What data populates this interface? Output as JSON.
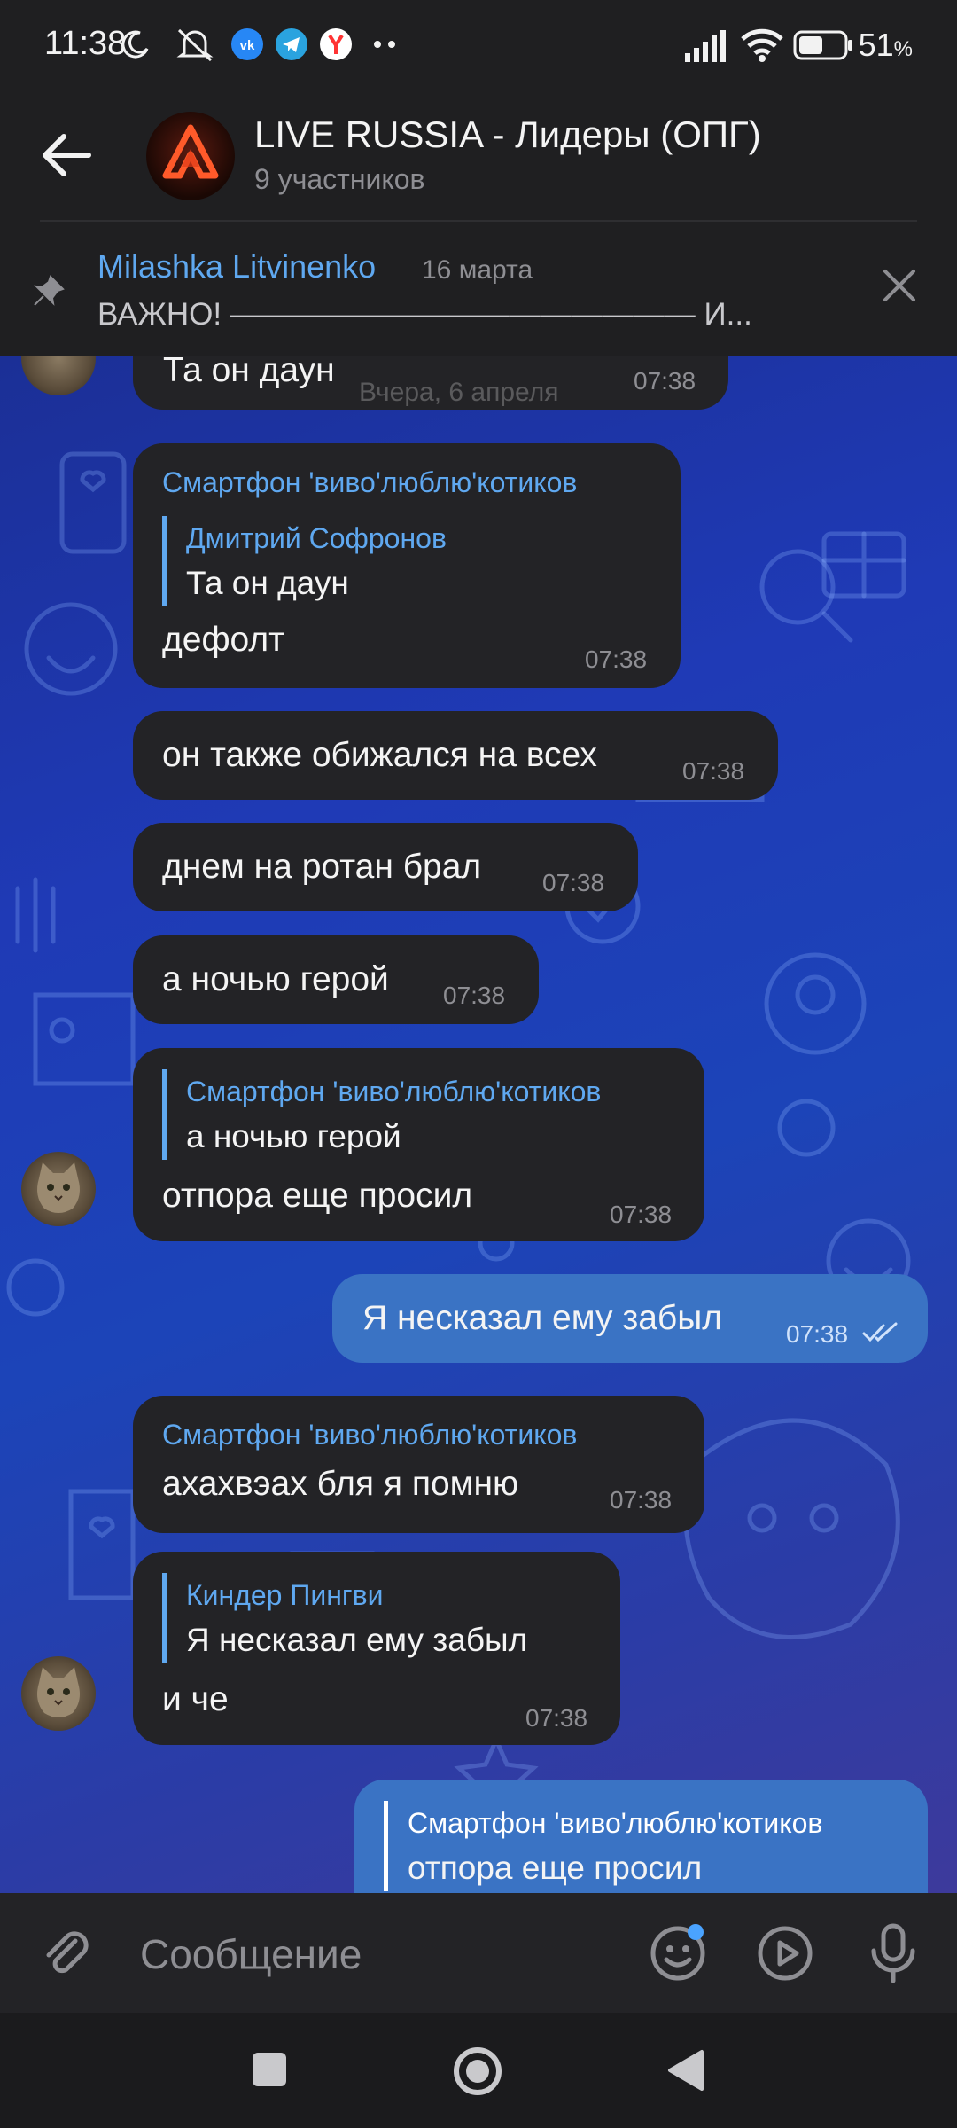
{
  "status_bar": {
    "time": "11:38",
    "battery": "51",
    "battery_unit": "%",
    "icons": [
      "moon-icon",
      "mute-icon",
      "vk-icon",
      "telegram-icon",
      "yandex-icon",
      "more-dots-icon",
      "signal-icon",
      "wifi-icon",
      "battery-icon"
    ]
  },
  "header": {
    "title": "LIVE RUSSIA - Лидеры (ОПГ)",
    "subtitle": "9 участников"
  },
  "pinned": {
    "author": "Milashka Litvinenko",
    "date": "16 марта",
    "text": "ВАЖНО! ——————————————— И..."
  },
  "chat": {
    "date_divider": "Вчера, 6 апреля",
    "messages": [
      {
        "text": "Та он даун",
        "time": "07:38"
      },
      {
        "sender": "Смартфон 'виво'люблю'котиков",
        "quote_name": "Дмитрий Софронов",
        "quote_text": "Та он даун",
        "text": "дефолт",
        "time": "07:38"
      },
      {
        "text": "он также обижался на всех",
        "time": "07:38"
      },
      {
        "text": "днем на ротан брал",
        "time": "07:38"
      },
      {
        "text": "а ночью герой",
        "time": "07:38"
      },
      {
        "quote_name": "Смартфон 'виво'люблю'котиков",
        "quote_text": "а ночью герой",
        "text": "отпора еще просил",
        "time": "07:38"
      },
      {
        "text": "Я несказал ему забыл",
        "time": "07:38",
        "outgoing": true
      },
      {
        "sender": "Смартфон 'виво'люблю'котиков",
        "text": "ахахвэах бля я помню",
        "time": "07:38"
      },
      {
        "quote_name": "Киндер Пингви",
        "quote_text": "Я несказал ему забыл",
        "text": "и че",
        "time": "07:38"
      },
      {
        "quote_name": "Смартфон 'виво'люблю'котиков",
        "quote_text": "отпора еще просил",
        "outgoing": true
      }
    ]
  },
  "input": {
    "placeholder": "Сообщение"
  },
  "colors": {
    "accent": "#5fa8f0",
    "bubble_in": "#232326",
    "bubble_out": "#3a73c4",
    "bar_bg": "#1f1f21"
  }
}
